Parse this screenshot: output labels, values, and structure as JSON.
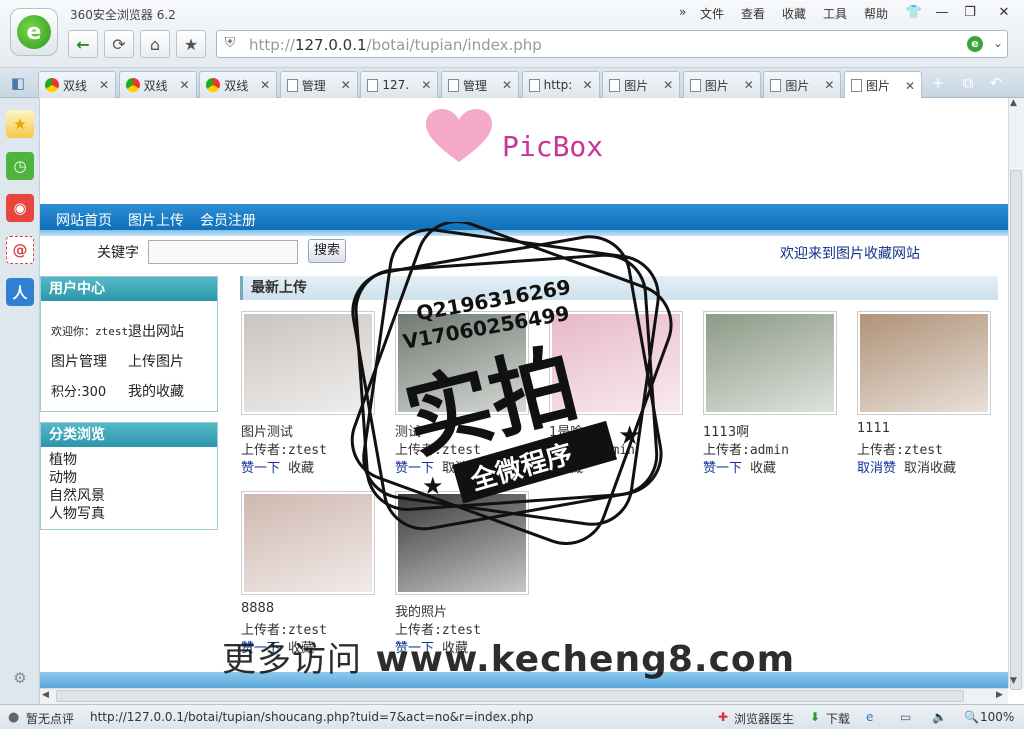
{
  "browser": {
    "title": "360安全浏览器 6.2",
    "menu": [
      "文件",
      "查看",
      "收藏",
      "工具",
      "帮助"
    ],
    "address_prefix": "http://",
    "address_host": "127.0.0.1",
    "address_path": "/botai/tupian/index.php"
  },
  "tabs": [
    {
      "label": "双线",
      "icon": "chrome-icon"
    },
    {
      "label": "双线",
      "icon": "chrome-icon"
    },
    {
      "label": "双线",
      "icon": "chrome-icon"
    },
    {
      "label": "管理",
      "icon": "page-icon"
    },
    {
      "label": "127.",
      "icon": "page-icon"
    },
    {
      "label": "管理",
      "icon": "page-icon"
    },
    {
      "label": "http:",
      "icon": "page-icon"
    },
    {
      "label": "图片",
      "icon": "page-icon"
    },
    {
      "label": "图片",
      "icon": "page-icon"
    },
    {
      "label": "图片",
      "icon": "page-icon"
    },
    {
      "label": "图片",
      "icon": "page-icon",
      "active": true
    }
  ],
  "site": {
    "brand": "PicBox",
    "nav": [
      "网站首页",
      "图片上传",
      "会员注册"
    ],
    "search_label": "关键字",
    "search_button": "搜索",
    "welcome": "欢迎来到图片收藏网站",
    "user_center": {
      "title": "用户中心",
      "greeting": "欢迎你：ztest",
      "logout": "退出网站",
      "manage": "图片管理",
      "upload": "上传图片",
      "points": "积分:300",
      "favorites": "我的收藏"
    },
    "categories": {
      "title": "分类浏览",
      "items": [
        "植物",
        "动物",
        "自然风景",
        "人物写真"
      ]
    },
    "latest_title": "最新上传",
    "pictures": [
      {
        "title": "图片测试",
        "uploader": "上传者:ztest",
        "like": "赞一下",
        "fav": "收藏",
        "tone": "#c9c4c0"
      },
      {
        "title": "测试",
        "uploader": "上传者:ztest",
        "like": "赞一下",
        "fav": "取消",
        "tone": "#6f7a70"
      },
      {
        "title": "1是啥",
        "uploader": "上传者:admin",
        "like": "",
        "fav": "收藏",
        "tone": "#e8b8c8"
      },
      {
        "title": "1113啊",
        "uploader": "上传者:admin",
        "like": "赞一下",
        "fav": "收藏",
        "tone": "#8d9a86"
      },
      {
        "title": "1111",
        "uploader": "上传者:ztest",
        "like": "取消赞",
        "fav": "取消收藏",
        "tone": "#b09278"
      },
      {
        "title": "8888",
        "uploader": "上传者:ztest",
        "like": "赞一下",
        "fav": "收藏",
        "tone": "#cfb8b0"
      },
      {
        "title": "我的照片",
        "uploader": "上传者:ztest",
        "like": "赞一下",
        "fav": "收藏",
        "tone": "#3a3a3e"
      }
    ]
  },
  "overlay": {
    "stamp_line1": "Q2196316269",
    "stamp_line2": "V17060256499",
    "stamp_big": "实拍",
    "stamp_banner": "全微程序",
    "watermark_cn": "更多访问",
    "watermark_url": "www.kecheng8.com"
  },
  "status": {
    "rating": "暂无点评",
    "link": "http://127.0.0.1/botai/tupian/shoucang.php?tuid=7&act=no&r=index.php",
    "doctor": "浏览器医生",
    "download": "下载",
    "zoom": "100%"
  }
}
